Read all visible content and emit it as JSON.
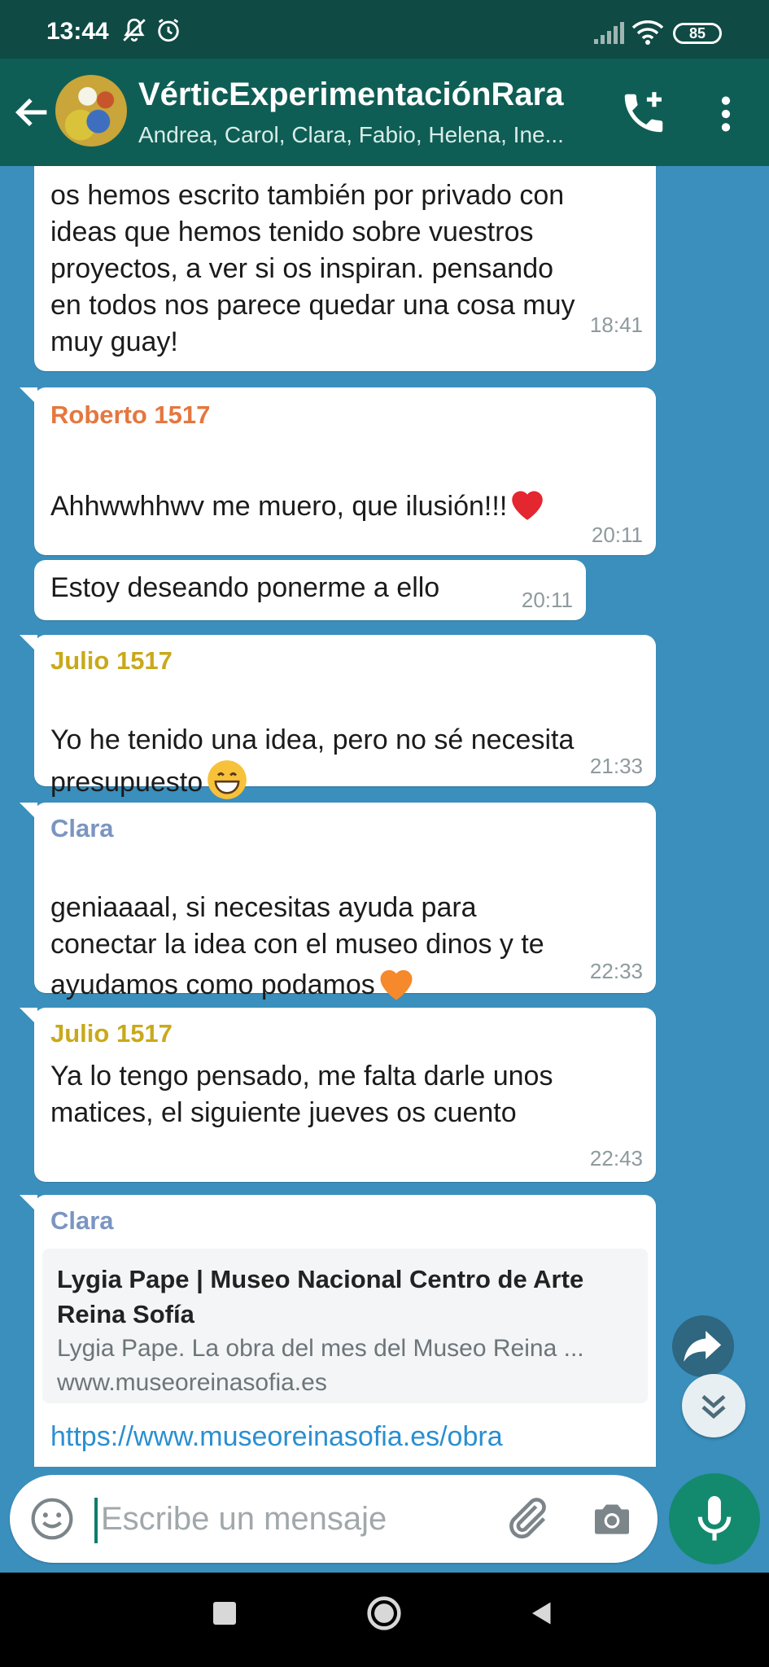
{
  "status_bar": {
    "time": "13:44",
    "battery": "85"
  },
  "header": {
    "group_name": "VérticExperimentaciónRara",
    "members": "Andrea, Carol, Clara, Fabio, Helena, Ine..."
  },
  "messages": [
    {
      "text": "os hemos escrito también por privado con\nideas que hemos tenido sobre vuestros\nproyectos, a ver si os inspiran. pensando\nen todos nos parece quedar una cosa muy\nmuy guay!",
      "time": "18:41"
    },
    {
      "sender": "Roberto 1517",
      "sender_color": "#e5773f",
      "text": "Ahhwwhhwv me muero, que ilusión!!!",
      "emoji": "red-heart",
      "time": "20:11"
    },
    {
      "text": "Estoy deseando ponerme a ello",
      "time": "20:11"
    },
    {
      "sender": "Julio 1517",
      "sender_color": "#c9a91a",
      "text": "Yo he tenido una idea, pero no sé necesita\npresupuesto",
      "emoji": "grinning-face",
      "time": "21:33"
    },
    {
      "sender": "Clara",
      "sender_color": "#7b95c2",
      "text": "geniaaaal, si necesitas ayuda para\nconectar la idea con el museo dinos y te\nayudamos como podamos",
      "emoji": "orange-heart",
      "time": "22:33"
    },
    {
      "sender": "Julio 1517",
      "sender_color": "#c9a91a",
      "text": "Ya lo tengo pensado, me falta darle unos\nmatices, el siguiente jueves os cuento",
      "time": "22:43"
    },
    {
      "sender": "Clara",
      "sender_color": "#7b95c2",
      "preview": {
        "title": "Lygia Pape | Museo Nacional Centro de Arte Reina Sofía",
        "description": "Lygia Pape. La obra del mes del Museo Reina ...",
        "domain": "www.museoreinasofia.es"
      },
      "link": "https://www.museoreinasofia.es/obra"
    }
  ],
  "input": {
    "placeholder": "Escribe un mensaje"
  },
  "colors": {
    "header": "#0f5e55",
    "status_bar": "#0f4a44",
    "chat_bg": "#3a8fbd",
    "mic": "#138a6e"
  }
}
